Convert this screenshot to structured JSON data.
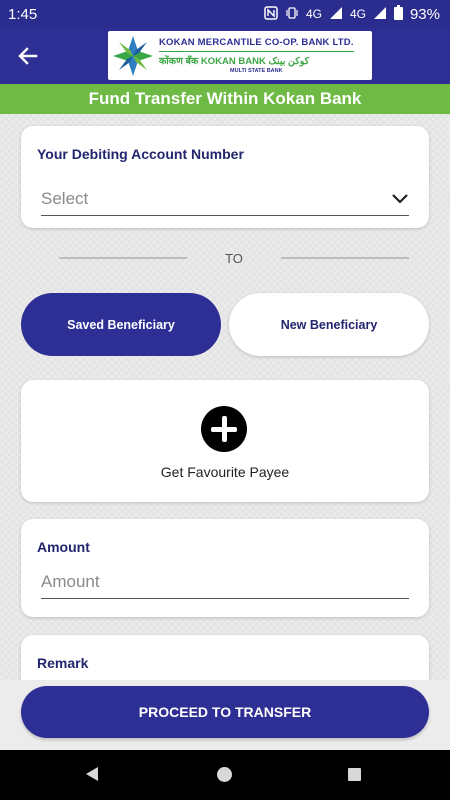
{
  "status_bar": {
    "time": "1:45",
    "network": "4G",
    "network2": "4G",
    "battery": "93%"
  },
  "header": {
    "logo": {
      "line1": "KOKAN MERCANTILE CO-OP. BANK LTD.",
      "line2": "कोंकण बँक KOKAN BANK کوکن بینک",
      "line3": "MULTI STATE BANK"
    },
    "title": "Fund Transfer Within Kokan Bank"
  },
  "debit_account": {
    "label": "Your Debiting Account Number",
    "placeholder": "Select"
  },
  "divider": {
    "text": "TO"
  },
  "beneficiary_tabs": [
    {
      "label": "Saved Beneficiary",
      "selected": true
    },
    {
      "label": "New Beneficiary",
      "selected": false
    }
  ],
  "favourite_payee": {
    "label": "Get Favourite Payee"
  },
  "amount": {
    "label": "Amount",
    "placeholder": "Amount"
  },
  "remark": {
    "label": "Remark"
  },
  "proceed_button": {
    "label": "PROCEED TO TRANSFER"
  },
  "colors": {
    "primary": "#2d2f94",
    "accent_green": "#6fba45",
    "background": "#ebebeb"
  }
}
